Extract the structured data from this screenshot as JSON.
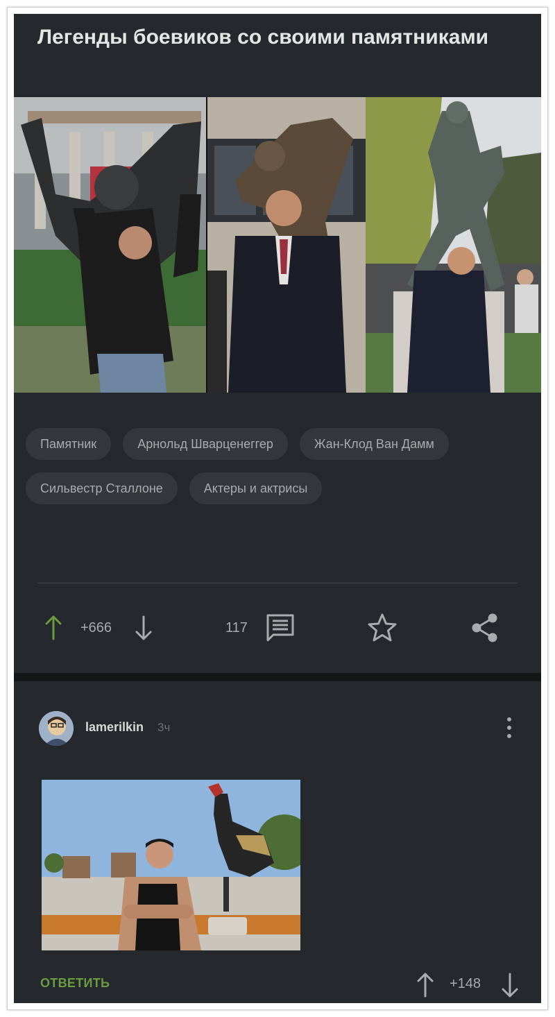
{
  "post": {
    "title": "Легенды боевиков со своими памятниками",
    "tags": [
      "Памятник",
      "Арнольд Шварценеггер",
      "Жан-Клод Ван Дамм",
      "Сильвестр Сталлоне",
      "Актеры и актрисы"
    ],
    "rating": "+666",
    "comments_count": "117",
    "accent_color": "#6b9c3f",
    "background_color": "#25282c"
  },
  "comment": {
    "username": "lamerilkin",
    "time": "3ч",
    "reply_label": "ОТВЕТИТЬ",
    "rating": "+148"
  },
  "icons": {
    "upvote": "arrow-up-icon",
    "downvote": "arrow-down-icon",
    "comments": "comment-bubble-icon",
    "save": "star-icon",
    "share": "share-icon",
    "menu": "more-vertical-icon"
  }
}
